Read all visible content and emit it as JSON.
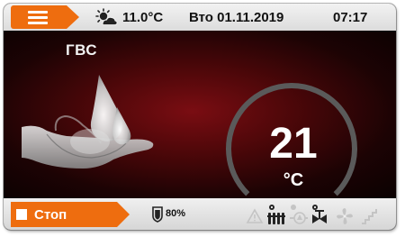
{
  "topbar": {
    "weather_icon": "partly-sunny-icon",
    "temperature": "11.0°C",
    "date": "Вто 01.11.2019",
    "time": "07:17"
  },
  "main": {
    "section_title": "ГВС",
    "image_icon": "hand-water-drops-icon",
    "gauge": {
      "value": "21",
      "unit": "°C",
      "fill_fraction": 1.0
    }
  },
  "bottombar": {
    "stop_label": "Стоп",
    "battery_icon": "shield-battery-icon",
    "battery_percent": "80%",
    "status_icons": [
      "warning-icon",
      "radiator-icon",
      "pump-icon",
      "valve-icon",
      "fan-icon",
      "stairs-icon"
    ]
  },
  "colors": {
    "accent": "#ee6d0f",
    "background_main": "#4c0709",
    "gauge_arc": "#5a5a5a",
    "text_light": "#ffffff"
  }
}
